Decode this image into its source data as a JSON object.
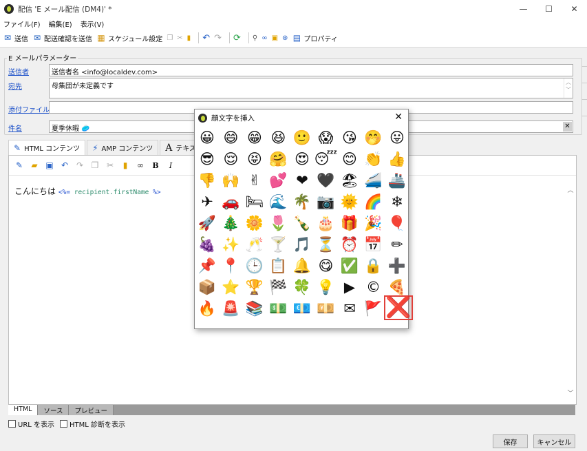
{
  "window": {
    "title": "配信 'E メール配信 (DM4)' *",
    "buttons": [
      "—",
      "☐",
      "✕"
    ]
  },
  "menu": [
    "ファイル(F)",
    "編集(E)",
    "表示(V)"
  ],
  "toolbar": {
    "send": "送信",
    "send_proof": "配送確認を送信",
    "schedule": "スケジュール設定",
    "properties": "プロパティ"
  },
  "params": {
    "group_title": "E メールパラメーター",
    "sender_label": "送信者",
    "sender_value": "送信者名 <info@localdev.com>",
    "to_label": "宛先",
    "to_value": "母集団が未定義です",
    "attach_label": "添付ファイル",
    "attach_value": "",
    "subject_label": "件名",
    "subject_value": "夏季休暇 🥏"
  },
  "tabs": {
    "html": "HTML コンテンツ",
    "amp": "AMP コンテンツ",
    "text": "テキストコン"
  },
  "editor": {
    "greeting": "こんにちは ",
    "code_open": "<%=",
    "code_body": " recipient.firstName ",
    "code_close": "%>"
  },
  "bottom_tabs": [
    "HTML",
    "ソース",
    "プレビュー"
  ],
  "checks": {
    "show_url": "URL を表示",
    "html_diag": "HTML 診断を表示"
  },
  "buttons": {
    "save": "保存",
    "cancel": "キャンセル"
  },
  "dialog": {
    "title": "顔文字を挿入",
    "close": "✕",
    "emojis": [
      "😀",
      "😄",
      "😁",
      "😆",
      "🙂",
      "😱",
      "😘",
      "🤭",
      "😛",
      "😎",
      "😌",
      "😝",
      "🤗",
      "😍",
      "😴",
      "😊",
      "👏",
      "👍",
      "👎",
      "🙌",
      "✌",
      "💕",
      "❤",
      "🖤",
      "🏖",
      "🚄",
      "🚢",
      "✈",
      "🚗",
      "🛏",
      "🌊",
      "🌴",
      "📷",
      "🌞",
      "🌈",
      "❄",
      "🚀",
      "🎄",
      "🌼",
      "🌷",
      "🍾",
      "🎂",
      "🎁",
      "🎉",
      "🎈",
      "🍇",
      "✨",
      "🥂",
      "🍸",
      "🎵",
      "⏳",
      "⏰",
      "📅",
      "✏",
      "📌",
      "📍",
      "🕒",
      "📋",
      "🔔",
      "😋",
      "✅",
      "🔒",
      "➕",
      "📦",
      "⭐",
      "🏆",
      "🏁",
      "🍀",
      "💡",
      "▶",
      "©",
      "🍕",
      "🔥",
      "🚨",
      "📚",
      "💵",
      "💶",
      "💴",
      "✉",
      "🚩",
      "❌"
    ]
  }
}
